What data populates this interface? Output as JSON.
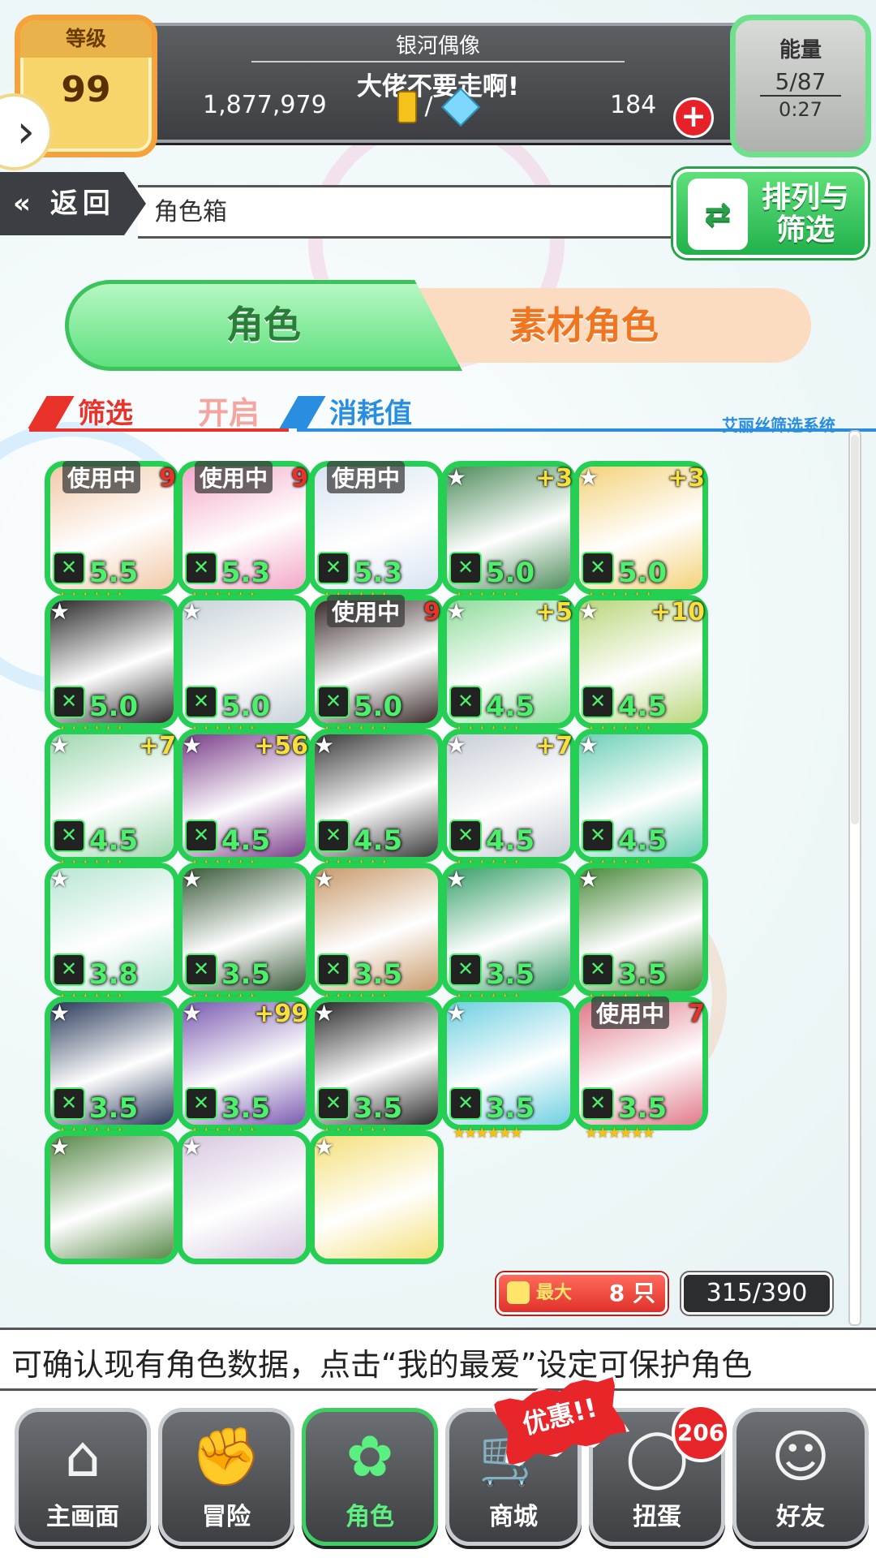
{
  "header": {
    "level_label": "等级",
    "level_value": "99",
    "title": "银河偶像",
    "subtitle": "大佬不要走啊!",
    "gold": "1,877,979",
    "currency_separator": "/",
    "gems": "184",
    "energy_label": "能量",
    "energy_value": "5/87",
    "energy_timer": "0:27"
  },
  "nav_bar": {
    "back_label": "返回",
    "page_title": "角色箱",
    "sort_filter_label": "排列与筛选"
  },
  "tabs": [
    {
      "label": "角色",
      "active": true
    },
    {
      "label": "素材角色",
      "active": false
    }
  ],
  "filter": {
    "filter_label": "筛选",
    "filter_state": "开启",
    "cost_label": "消耗值",
    "system_label": "艾丽丝筛选系统"
  },
  "characters": [
    {
      "in_use": "使用中",
      "plus": "9",
      "level": "5.5",
      "star": false
    },
    {
      "in_use": "使用中",
      "plus": "9",
      "level": "5.3",
      "star": false
    },
    {
      "in_use": "使用中",
      "plus": "",
      "level": "5.3",
      "star": false
    },
    {
      "in_use": "",
      "plus": "+3",
      "level": "5.0",
      "star": true
    },
    {
      "in_use": "",
      "plus": "+3",
      "level": "5.0",
      "star": true
    },
    {
      "in_use": "",
      "plus": "",
      "level": "5.0",
      "star": true
    },
    {
      "in_use": "",
      "plus": "",
      "level": "5.0",
      "star": true
    },
    {
      "in_use": "使用中",
      "plus": "9",
      "level": "5.0",
      "star": false
    },
    {
      "in_use": "",
      "plus": "+5",
      "level": "4.5",
      "star": true
    },
    {
      "in_use": "",
      "plus": "+10",
      "level": "4.5",
      "star": true
    },
    {
      "in_use": "",
      "plus": "+7",
      "level": "4.5",
      "star": true
    },
    {
      "in_use": "",
      "plus": "+56",
      "level": "4.5",
      "star": true
    },
    {
      "in_use": "",
      "plus": "",
      "level": "4.5",
      "star": true
    },
    {
      "in_use": "",
      "plus": "+7",
      "level": "4.5",
      "star": true
    },
    {
      "in_use": "",
      "plus": "",
      "level": "4.5",
      "star": true
    },
    {
      "in_use": "",
      "plus": "",
      "level": "3.8",
      "star": true
    },
    {
      "in_use": "",
      "plus": "",
      "level": "3.5",
      "star": true
    },
    {
      "in_use": "",
      "plus": "",
      "level": "3.5",
      "star": true
    },
    {
      "in_use": "",
      "plus": "",
      "level": "3.5",
      "star": true
    },
    {
      "in_use": "",
      "plus": "",
      "level": "3.5",
      "star": true
    },
    {
      "in_use": "",
      "plus": "",
      "level": "3.5",
      "star": true
    },
    {
      "in_use": "",
      "plus": "+99",
      "level": "3.5",
      "star": true
    },
    {
      "in_use": "",
      "plus": "",
      "level": "3.5",
      "star": true
    },
    {
      "in_use": "",
      "plus": "",
      "level": "3.5",
      "star": true
    },
    {
      "in_use": "使用中",
      "plus": "7",
      "level": "3.5",
      "star": false
    },
    {
      "in_use": "",
      "plus": "",
      "level": "",
      "star": true
    },
    {
      "in_use": "",
      "plus": "",
      "level": "",
      "star": true
    },
    {
      "in_use": "",
      "plus": "",
      "level": "",
      "star": true
    }
  ],
  "card_colors": [
    "#f2c9a8",
    "#f4a7c8",
    "#d8e4f2",
    "#4f8d5c",
    "#f4d27a",
    "#2b2b2b",
    "#c9d3da",
    "#3a2a2a",
    "#8fdc9c",
    "#b9d67a",
    "#9fd8b0",
    "#7a3e8a",
    "#3a3a3a",
    "#c8cdd6",
    "#6ed0b8",
    "#b8e6d4",
    "#3a5a3a",
    "#c89a6a",
    "#3aa06a",
    "#4a8a3a",
    "#2a3a5a",
    "#7a5ab0",
    "#2a2a2a",
    "#6ed0e0",
    "#e07a8a",
    "#5a8a4a",
    "#d8c8e0",
    "#f4e07a"
  ],
  "roster": {
    "max_label": "最大",
    "max_value": "8 只",
    "capacity": "315/390"
  },
  "ticker": "可确认现有角色数据，点击“我的最爱”设定可保护角色",
  "bottom_nav": [
    {
      "label": "主画面",
      "icon": "home-icon",
      "glyph": "⌂"
    },
    {
      "label": "冒险",
      "icon": "handshake-icon",
      "glyph": "✊"
    },
    {
      "label": "角色",
      "icon": "bunny-icon",
      "glyph": "✿"
    },
    {
      "label": "商城",
      "icon": "cart-icon",
      "glyph": "🛒"
    },
    {
      "label": "扭蛋",
      "icon": "egg-icon",
      "glyph": "◯"
    },
    {
      "label": "好友",
      "icon": "friends-icon",
      "glyph": "☺"
    }
  ],
  "sale_badge": "优惠!!",
  "gacha_count": "206",
  "accent_colors": {
    "green": "#25cf53",
    "red": "#e8322a",
    "blue": "#2a8ee0",
    "orange": "#f07520"
  }
}
